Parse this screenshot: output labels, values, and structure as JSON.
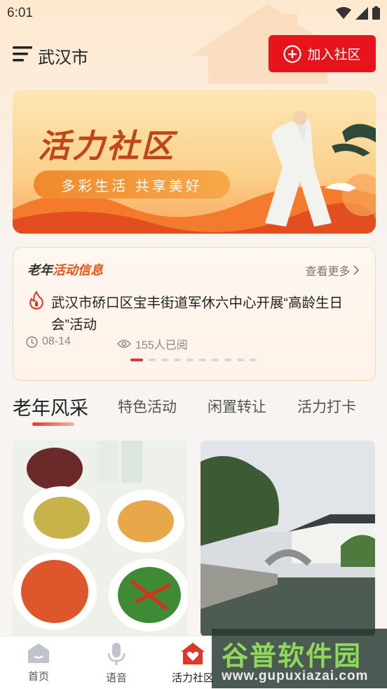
{
  "status_bar": {
    "time": "6:01"
  },
  "header": {
    "city": "武汉市",
    "join_label": "加入社区"
  },
  "banner": {
    "title": "活力社区",
    "slogan": "多彩生活 共享美好"
  },
  "news": {
    "title_part1": "老年",
    "title_part2": "活动信息",
    "more_label": "查看更多",
    "text": "武汉市硚口区宝丰街道军休六中心开展“高龄生日会”活动",
    "date": "08-14",
    "views": "155人已阅",
    "page_count": 10,
    "active_page": 0
  },
  "tabs": [
    "老年风采",
    "特色活动",
    "闲置转让",
    "活力打卡"
  ],
  "active_tab": 0,
  "cards": [
    {
      "icon": "food-photo"
    },
    {
      "icon": "waterside-town-photo"
    }
  ],
  "bottom_nav": [
    {
      "label": "首页",
      "icon": "home-icon"
    },
    {
      "label": "语音",
      "icon": "microphone-icon"
    },
    {
      "label": "活力社区",
      "icon": "community-heart-icon"
    }
  ],
  "watermark": {
    "title": "谷普软件园",
    "url": "www.gupuxiazai.com"
  },
  "colors": {
    "accent": "#e8141c",
    "news_orange": "#e5541c"
  }
}
